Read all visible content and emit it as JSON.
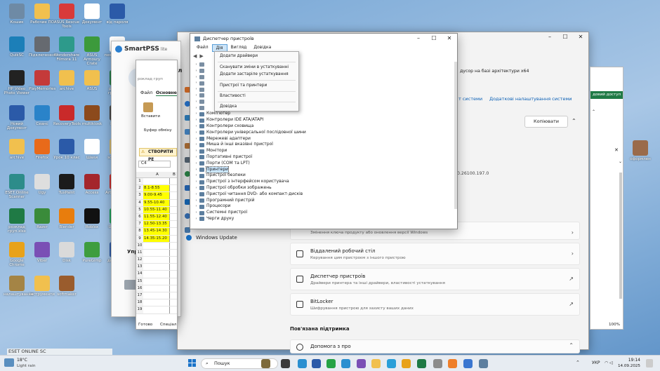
{
  "desktop_icons": [
    {
      "label": "Кошик",
      "color": "#6e8aa5"
    },
    {
      "label": "Рабочие ПО",
      "color": "#f1c04e"
    },
    {
      "label": "ASUS Rescue Tools",
      "color": "#d83a3a"
    },
    {
      "label": "Документ",
      "color": "#ffffff"
    },
    {
      "label": "від пароля",
      "color": "#2b5aa8"
    },
    {
      "label": "QuikSC",
      "color": "#1c7fb8"
    },
    {
      "label": "Підключення",
      "color": "#666a70"
    },
    {
      "label": "Wondershare Filmora 11",
      "color": "#2d9a8b"
    },
    {
      "label": "ASUS Armoury Crate",
      "color": "#3c9a3c"
    },
    {
      "label": "new ordering",
      "color": "#ffffff"
    },
    {
      "label": "HP Video Photo Viewer",
      "color": "#222222"
    },
    {
      "label": "PlayMemories",
      "color": "#c43a3a"
    },
    {
      "label": "archive",
      "color": "#f1c04e"
    },
    {
      "label": "ASUS",
      "color": "#f1c04e"
    },
    {
      "label": "розклад груп.xlsx",
      "color": "#1f7a45"
    },
    {
      "label": "Новий Документ",
      "color": "#2b5aa8"
    },
    {
      "label": "Сеанс",
      "color": "#2a83c9"
    },
    {
      "label": "RecoveryTools",
      "color": "#c92a2a"
    },
    {
      "label": "multikiosk",
      "color": "#8c4a1c"
    },
    {
      "label": "Rsmart",
      "color": "#444"
    },
    {
      "label": "archive",
      "color": "#f1c04e"
    },
    {
      "label": "Firefox",
      "color": "#e86a1a"
    },
    {
      "label": "Урок 10 клас",
      "color": "#2b5aa8"
    },
    {
      "label": "Шахи",
      "color": "#ffffff"
    },
    {
      "label": "softmaker",
      "color": "#d4b96e"
    },
    {
      "label": "ESET Online Scanner",
      "color": "#2d8c8a"
    },
    {
      "label": "Ugy",
      "color": "#dedede"
    },
    {
      "label": "TuxPaint",
      "color": "#1b1b1b"
    },
    {
      "label": "Access",
      "color": "#a4262c"
    },
    {
      "label": "ArtsCAD DPI",
      "color": "#c92a2a"
    },
    {
      "label": "розклад груп.xlsx",
      "color": "#1f7a45"
    },
    {
      "label": "Razer",
      "color": "#3a8b3a"
    },
    {
      "label": "Blender",
      "color": "#e87d0d"
    },
    {
      "label": "Roblox",
      "color": "#111111"
    },
    {
      "label": "UltraVNC",
      "color": "#1aa05a"
    },
    {
      "label": "Google Chrome",
      "color": "#e8a21a"
    },
    {
      "label": "Viber",
      "color": "#7a4fb5"
    },
    {
      "label": "Disk",
      "color": "#dadada"
    },
    {
      "label": "PureGimp",
      "color": "#3e9d3e"
    },
    {
      "label": "документ",
      "color": "#2b5aa8"
    },
    {
      "label": "налаштування",
      "color": "#a48445"
    },
    {
      "label": "інструменти",
      "color": "#f1c04e"
    },
    {
      "label": "softmaker",
      "color": "#9a5c2d"
    }
  ],
  "settings": {
    "processor_text": "дусор на базі архітектури x64",
    "link1": "т системи",
    "link2": "Додаткові налаштування системи",
    "copy_btn": "Копіювати",
    "version": "0.26100.197.0",
    "windows_update": "Windows Update",
    "change_key": "Змінення ключа продукту або оновлення версії Windows",
    "cards": [
      {
        "title": "Віддалений робочий стіл",
        "subtitle": "Керування цим пристроєм з іншого пристрою",
        "kind": "chevron"
      },
      {
        "title": "Диспетчер пристроїв",
        "subtitle": "Драйвери принтера та інші драйвери, властивості устаткування",
        "kind": "external"
      },
      {
        "title": "BitLocker",
        "subtitle": "Шифрування пристрою для захисту ваших даних",
        "kind": "external"
      }
    ],
    "related_support": "Пов'язана підтримка",
    "help_from": "Допомога з про"
  },
  "smartpss": {
    "title": "SmartPSS",
    "suffix": "lite",
    "pere": "Перегл",
    "upr": "Упр"
  },
  "excel": {
    "search": "роклад груп",
    "tab_file": "Файл",
    "tab_main": "Основне",
    "paste": "Вставити",
    "clipboard": "Буфер обміну",
    "alert": "СТВОРИТИ РЕ",
    "cellref": "C4",
    "col_a": "A",
    "col_b": "B",
    "rows": [
      "8.1-8.55",
      "9.00-9.45",
      "9.55-10.40",
      "10.55-11.40",
      "11.55-12.40",
      "12.50-13.35",
      "13.45-14.30",
      "14.35-15.20"
    ],
    "status": "Готово",
    "status2": "Спеціал"
  },
  "devmgr": {
    "title": "Диспетчер пристроїв",
    "menu": [
      "Файл",
      "Дія",
      "Вигляд",
      "Довідка"
    ],
    "action_menu": [
      "Додати драйвери",
      "Сканувати зміни в устаткуванні",
      "Додати застаріле устаткування",
      "Пристрої та принтери",
      "Властивості",
      "Довідка"
    ],
    "tree": [
      "Комп'ютер",
      "Контролери IDE ATA/ATAPI",
      "Контролери сховища",
      "Контролери універсальної послідовної шини",
      "Мережеві адаптери",
      "Миша й інші вказівні пристрої",
      "Монітори",
      "Портативні пристрої",
      "Порти (COM та LPT)",
      "Принтери",
      "Пристрої безпеки",
      "Пристрої з інтерфейсом користувача",
      "Пристрої обробки зображень",
      "Пристрої читання DVD- або компакт-дисків",
      "Програмний пристрій",
      "Процесори",
      "Системні пристрої",
      "Черги друку"
    ],
    "selected_index": 9
  },
  "right_window": {
    "btn": "довий доступ",
    "zoom": "100%"
  },
  "desktop_right_icon": "оформлен",
  "eset_banner": "ESET ONLINE SC",
  "taskbar": {
    "temp": "18°C",
    "weather": "Light rain",
    "search": "Пошук",
    "lang": "УКР",
    "time": "19:14",
    "date": "14.09.2025"
  }
}
